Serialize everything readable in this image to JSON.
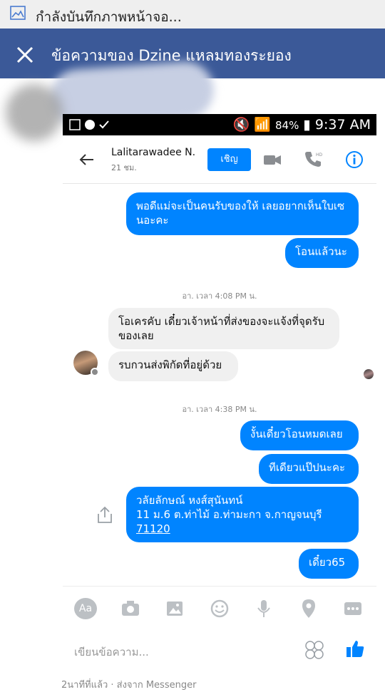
{
  "notification": {
    "icon": "image-icon",
    "text": "กำลังบันทึกภาพหน้าจอ..."
  },
  "app_bar": {
    "title": "ข้อความของ Dzine แหลมทองระยอง",
    "close_icon": "close-icon",
    "color": "#3b5998"
  },
  "phone": {
    "status_bar": {
      "battery": "84%",
      "time": "9:37 AM"
    },
    "header": {
      "contact_name": "Lalitarawadee N...",
      "active_status": "21 ชม.",
      "invite_label": "เชิญ",
      "accent_color": "#0084ff"
    },
    "messages": [
      {
        "side": "me",
        "text": "พอดีแม่จะเป็นคนรับของให้ เลยอยากเห็นใบเซนอะคะ"
      },
      {
        "side": "me",
        "text": "โอนแล้วนะ"
      },
      {
        "type": "timestamp",
        "text": "อา. เวลา 4:08 PM น."
      },
      {
        "side": "them",
        "text": "โอเครคับ เดี๋ยวเจ้าหน้าที่ส่งของจะแจ้งที่จุดรับของเลย"
      },
      {
        "side": "them",
        "text": "รบกวนส่งพิกัดที่อยู่ด้วย"
      },
      {
        "type": "timestamp",
        "text": "อา. เวลา 4:38 PM น."
      },
      {
        "side": "me",
        "text": "งั้นเดี๋ยวโอนหมดเลย"
      },
      {
        "side": "me",
        "text": "ทีเดียวแป๊ปนะคะ"
      },
      {
        "side": "me",
        "address_line1": "วลัยลักษณ์ หงส์สุนันทน์",
        "address_line2": "11 ม.6 ต.ท่าไม้ อ.ท่ามะกา จ.กาญจนบุรี",
        "postcode": "71120"
      },
      {
        "side": "me",
        "text": "เดี๋ยว65"
      }
    ],
    "composer": {
      "aa_label": "Aa",
      "placeholder": "เขียนข้อความ..."
    }
  },
  "footer_text": "2นาทีที่แล้ว · ส่งจาก Messenger"
}
